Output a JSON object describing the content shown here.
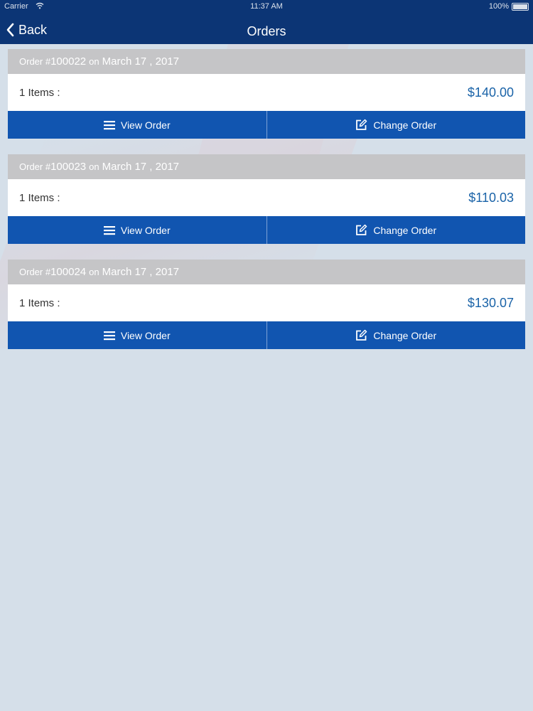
{
  "status_bar": {
    "carrier": "Carrier",
    "time": "11:37 AM",
    "battery": "100%"
  },
  "nav": {
    "back_label": "Back",
    "title": "Orders"
  },
  "orders": [
    {
      "prefix": "Order #",
      "number": "100022",
      "on": "on",
      "date": "March 17 , 2017",
      "items": "1 Items :",
      "price": "$140.00",
      "view_label": "View Order",
      "change_label": "Change Order"
    },
    {
      "prefix": "Order #",
      "number": "100023",
      "on": "on",
      "date": "March 17 , 2017",
      "items": "1 Items :",
      "price": "$110.03",
      "view_label": "View Order",
      "change_label": "Change Order"
    },
    {
      "prefix": "Order #",
      "number": "100024",
      "on": "on",
      "date": "March 17 , 2017",
      "items": "1 Items :",
      "price": "$130.07",
      "view_label": "View Order",
      "change_label": "Change Order"
    }
  ],
  "colors": {
    "header_bg": "#0c3575",
    "card_header_bg": "#c5c5c7",
    "action_bg": "#1155b0",
    "price_text": "#1a63a8",
    "page_bg": "#d5dfe9"
  },
  "icons": {
    "back": "chevron-left-icon",
    "view": "menu-icon",
    "change": "edit-icon",
    "wifi": "wifi-icon",
    "battery": "battery-icon"
  }
}
